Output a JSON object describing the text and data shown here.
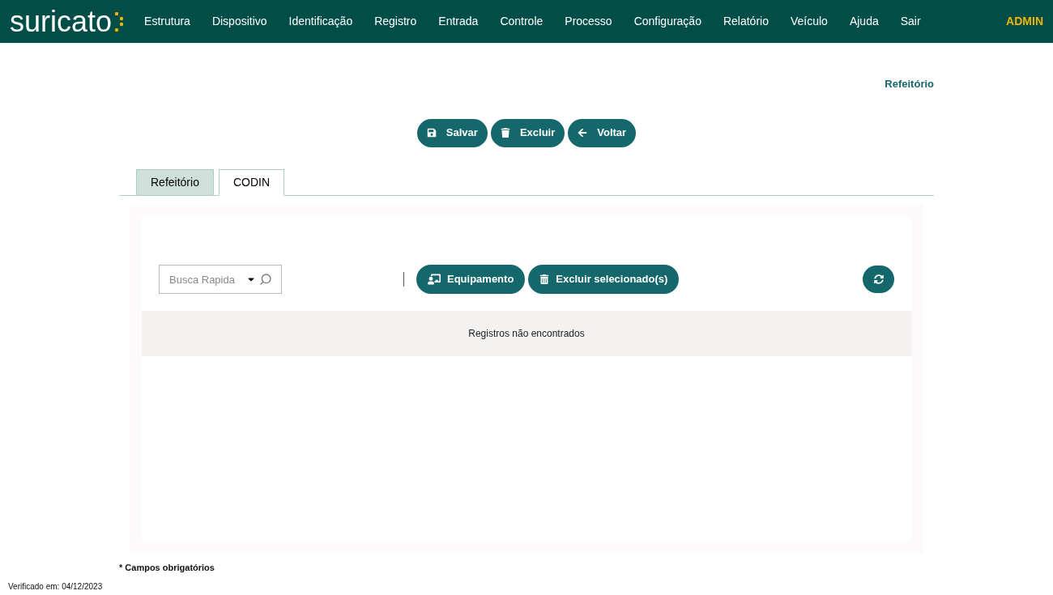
{
  "logo": {
    "text": "suricato"
  },
  "nav": [
    {
      "label": "Estrutura"
    },
    {
      "label": "Dispositivo"
    },
    {
      "label": "Identificação"
    },
    {
      "label": "Registro"
    },
    {
      "label": "Entrada"
    },
    {
      "label": "Controle"
    },
    {
      "label": "Processo"
    },
    {
      "label": "Configuração"
    },
    {
      "label": "Relatório"
    },
    {
      "label": "Veículo"
    },
    {
      "label": "Ajuda"
    },
    {
      "label": "Sair"
    }
  ],
  "user": "ADMIN",
  "page_title": "Refeitório",
  "actions": [
    {
      "label": "Salvar",
      "kind": "save"
    },
    {
      "label": "Excluir",
      "kind": "delete"
    },
    {
      "label": "Voltar",
      "kind": "back"
    }
  ],
  "tabs": [
    {
      "label": "Refeitório",
      "selected": false
    },
    {
      "label": "CODIN",
      "selected": true
    }
  ],
  "search": {
    "placeholder": "Busca Rapida"
  },
  "toolbar": [
    {
      "label": "Equipamento",
      "kind": "equipment"
    },
    {
      "label": "Excluir selecionado(s)",
      "kind": "delete"
    }
  ],
  "table": {
    "empty_message": "Registros não encontrados"
  },
  "footnote": "* Campos obrigatórios",
  "verified": "Verificado em: 04/12/2023"
}
